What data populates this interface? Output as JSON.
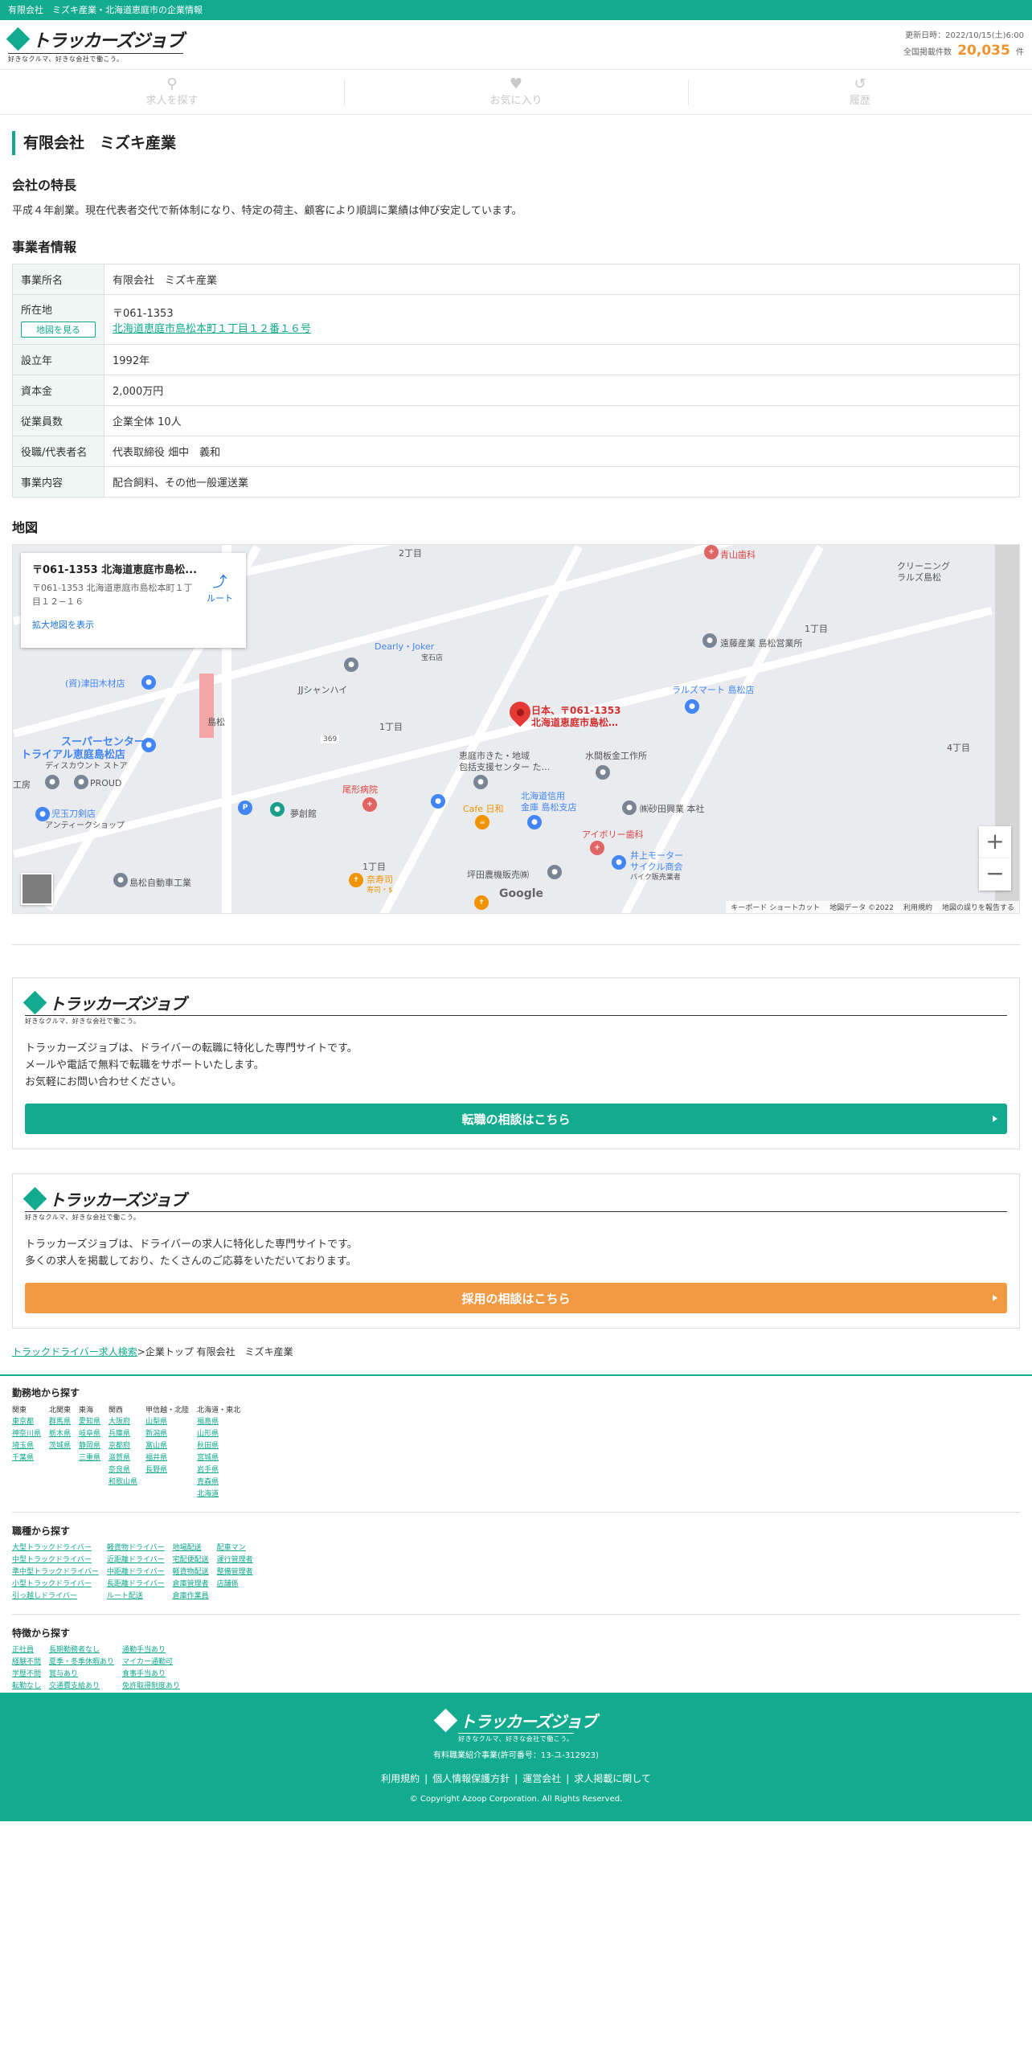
{
  "topbar": {
    "text": "有限会社　ミズキ産業・北海道恵庭市の企業情報"
  },
  "header": {
    "logo_text": "トラッカーズジョブ",
    "logo_tagline": "好きなクルマ、好きな会社で働こう。",
    "updated_label": "更新日時：2022/10/15(土)6:00",
    "count_label": "全国掲載件数",
    "count_value": "20,035",
    "count_unit": "件"
  },
  "nav": [
    {
      "label": "求人を探す",
      "icon": "search-icon"
    },
    {
      "label": "お気に入り",
      "icon": "heart-icon"
    },
    {
      "label": "履歴",
      "icon": "history-icon"
    }
  ],
  "company": {
    "title": "有限会社　ミズキ産業",
    "feature_heading": "会社の特長",
    "feature_text": "平成４年創業。現在代表者交代で新体制になり、特定の荷主、顧客により順調に業績は伸び安定しています。",
    "info_heading": "事業者情報",
    "rows": {
      "name_label": "事業所名",
      "name_value": "有限会社　ミズキ産業",
      "address_label": "所在地",
      "map_button": "地図を見る",
      "postal": "〒061-1353",
      "address_link": "北海道恵庭市島松本町１丁目１２番１６号",
      "founded_label": "設立年",
      "founded_value": "1992年",
      "capital_label": "資本金",
      "capital_value": "2,000万円",
      "employees_label": "従業員数",
      "employees_value": "企業全体 10人",
      "rep_label": "役職/代表者名",
      "rep_value": "代表取締役 畑中　義和",
      "business_label": "事業内容",
      "business_value": "配合飼料、その他一般運送業"
    }
  },
  "map": {
    "heading": "地図",
    "card_title": "〒061-1353 北海道恵庭市島松...",
    "card_address": "〒061-1353 北海道恵庭市島松本町１丁目１２−１６",
    "card_link": "拡大地図を表示",
    "route_label": "ルート",
    "pin_label_1": "日本、〒061-1353",
    "pin_label_2": "北海道恵庭市島松…",
    "labels": {
      "l1": "2丁目",
      "l2": "青山歯科",
      "l3": "クリーニング",
      "l4": "ラルズ島松",
      "l5": "遠藤産業 島松営業所",
      "l6": "1丁目",
      "l7": "Dearly・Joker",
      "l8": "(資)津田木材店",
      "l9": "JJシャンハイ",
      "l10": "ラルズマート 島松店",
      "l11": "島松",
      "l12": "1丁目",
      "l13": "スーパーセンター",
      "l14": "トライアル恵庭島松店",
      "l15": "恵庭市きた・地域",
      "l16": "包括支援センター た…",
      "l17": "水間板金工作所",
      "l18": "4丁目",
      "l19": "PROUD",
      "l20": "尾形病院",
      "l21": "北海道信用",
      "l22": "金庫 島松支店",
      "l23": "㈱砂田興業 本社",
      "l24": "児玉刀剣店",
      "l25": "夢創館",
      "l26": "Cafe 日和",
      "l27": "アイボリー歯科",
      "l28": "井上モーター",
      "l29": "サイクル商会",
      "l30": "1丁目",
      "l31": "島松自動車工業",
      "l32": "坪田農機販売㈱",
      "l33": "奈寿司",
      "l34": "369",
      "l35": "ディスカウント ストア",
      "l36": "アンティークショップ",
      "l37": "バイク販売業者",
      "l38": "寿司・$",
      "l39": "宝石店",
      "l40": "工房"
    },
    "google": "Google",
    "footer_items": [
      "キーボード ショートカット",
      "地図データ ©2022",
      "利用規約",
      "地図の誤りを報告する"
    ]
  },
  "promo1": {
    "text_lines": [
      "トラッカーズジョブは、ドライバーの転職に特化した専門サイトです。",
      "メールや電話で無料で転職をサポートいたします。",
      "お気軽にお問い合わせください。"
    ],
    "button": "転職の相談はこちら"
  },
  "promo2": {
    "text_lines": [
      "トラッカーズジョブは、ドライバーの求人に特化した専門サイトです。",
      "多くの求人を掲載しており、たくさんのご応募をいただいております。"
    ],
    "button": "採用の相談はこちら"
  },
  "breadcrumb": {
    "link": "トラックドライバー求人検索",
    "rest": ">企業トップ 有限会社　ミズキ産業"
  },
  "search_area": {
    "region_title": "勤務地から探す",
    "regions": [
      {
        "name": "関東",
        "items": [
          "東京都",
          "神奈川県",
          "埼玉県",
          "千葉県"
        ]
      },
      {
        "name": "北関東",
        "items": [
          "群馬県",
          "栃木県",
          "茨城県"
        ]
      },
      {
        "name": "東海",
        "items": [
          "愛知県",
          "岐阜県",
          "静岡県",
          "三重県"
        ]
      },
      {
        "name": "関西",
        "items": [
          "大阪府",
          "兵庫県",
          "京都府",
          "滋賀県",
          "奈良県",
          "和歌山県"
        ]
      },
      {
        "name": "甲信越・北陸",
        "items": [
          "山梨県",
          "新潟県",
          "富山県",
          "福井県",
          "長野県"
        ]
      },
      {
        "name": "北海道・東北",
        "items": [
          "福島県",
          "山形県",
          "秋田県",
          "宮城県",
          "岩手県",
          "青森県",
          "北海道"
        ]
      }
    ],
    "job_title": "職種から探す",
    "jobs": [
      [
        "大型トラックドライバー",
        "中型トラックドライバー",
        "準中型トラックドライバー",
        "小型トラックドライバー",
        "引っ越しドライバー"
      ],
      [
        "軽貨物ドライバー",
        "近距離ドライバー",
        "中距離ドライバー",
        "長距離ドライバー",
        "ルート配送"
      ],
      [
        "地場配送",
        "宅配便配送",
        "軽貨物配送",
        "倉庫管理者",
        "倉庫作業員"
      ],
      [
        "配車マン",
        "運行管理者",
        "整備管理者",
        "店舗係"
      ]
    ],
    "feature_title": "特徴から探す",
    "features": [
      [
        "正社員",
        "経験不問",
        "学歴不問",
        "転勤なし"
      ],
      [
        "長期勤務者なし",
        "夏季・冬季休暇あり",
        "賞与あり",
        "交通費支給あり"
      ],
      [
        "通勤手当あり",
        "マイカー通勤可",
        "食事手当あり",
        "免許取得制度あり"
      ]
    ]
  },
  "footer": {
    "logo_text": "トラッカーズジョブ",
    "logo_tagline": "好きなクルマ、好きな会社で働こう。",
    "license": "有料職業紹介事業(許可番号：13-ユ-312923)",
    "links": [
      "利用規約",
      "個人情報保護方針",
      "運営会社",
      "求人掲載に関して"
    ],
    "copyright": "© Copyright Azoop Corporation. All Rights Reserved."
  },
  "colors": {
    "brand_green": "#12ab8f",
    "accent_orange": "#f19a43",
    "count_orange": "#f0932c"
  }
}
